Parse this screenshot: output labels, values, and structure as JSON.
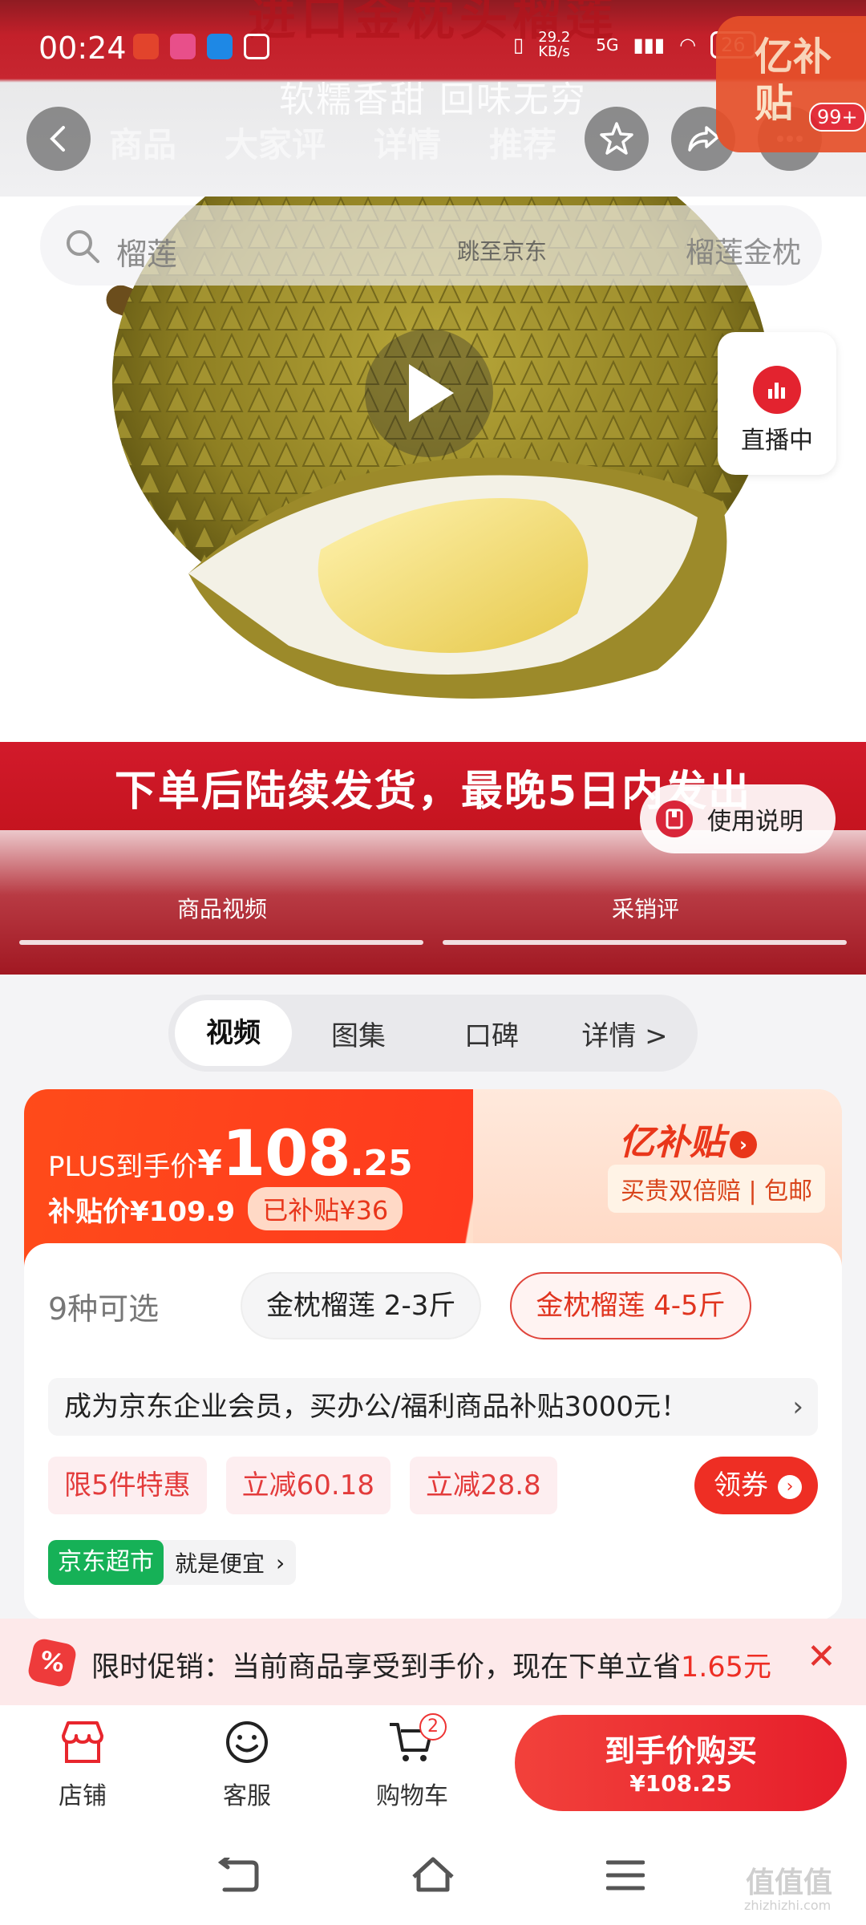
{
  "status_bar": {
    "time": "00:24",
    "net_speed": "29.2 KB/s",
    "network": "5G",
    "battery": "26"
  },
  "hero": {
    "banner_title": "进口金枕头榴莲",
    "banner_subtitle": "软糯香甜 回味无穷",
    "shipping_banner": "下单后陆续发货，最晚5日内发出",
    "media_tabs": [
      "商品视频",
      "采销评"
    ],
    "live_label": "直播中",
    "manual_label": "使用说明"
  },
  "header": {
    "tabs": [
      "商品",
      "大家评",
      "详情",
      "推荐"
    ],
    "badge_text": "亿补贴",
    "badge_count": "99+"
  },
  "search": {
    "placeholder": "榴莲",
    "middle": "跳至京东",
    "right": "榴莲金枕"
  },
  "segment": {
    "items": [
      "视频",
      "图集",
      "口碑",
      "详情 >"
    ],
    "selected": "视频"
  },
  "price": {
    "plus_label": "PLUS到手价",
    "currency": "¥",
    "integer": "108",
    "decimal": ".25",
    "subsidy_price": "补贴价¥109.9",
    "subsidy_badge": "已补贴¥36",
    "subsidy_brand": "亿补贴",
    "guarantee": "买贵双倍赔 | 包邮"
  },
  "sku": {
    "count_label": "9种可选",
    "options": [
      "金枕榴莲 2-3斤",
      "金枕榴莲 4-5斤"
    ],
    "selected_index": 1,
    "member_promo": "成为京东企业会员，买办公/福利商品补贴3000元！",
    "promos": [
      "限5件特惠",
      "立减60.18",
      "立减28.8"
    ],
    "coupon_label": "领券",
    "market_tag": "京东超市",
    "market_text": "就是便宜"
  },
  "promo_bar": {
    "text": "限时促销：当前商品享受到手价，现在下单立省",
    "amount": "1.65元"
  },
  "bottom_bar": {
    "shop": "店铺",
    "service": "客服",
    "cart": "购物车",
    "cart_count": "2",
    "buy_label": "到手价购买",
    "buy_price": "¥108.25"
  },
  "watermark": {
    "text": "值值值",
    "url": "zhizhizhi.com"
  },
  "colors": {
    "brand_red": "#e61e2b",
    "price_orange": "#ff4b1a",
    "market_green": "#16b157"
  }
}
